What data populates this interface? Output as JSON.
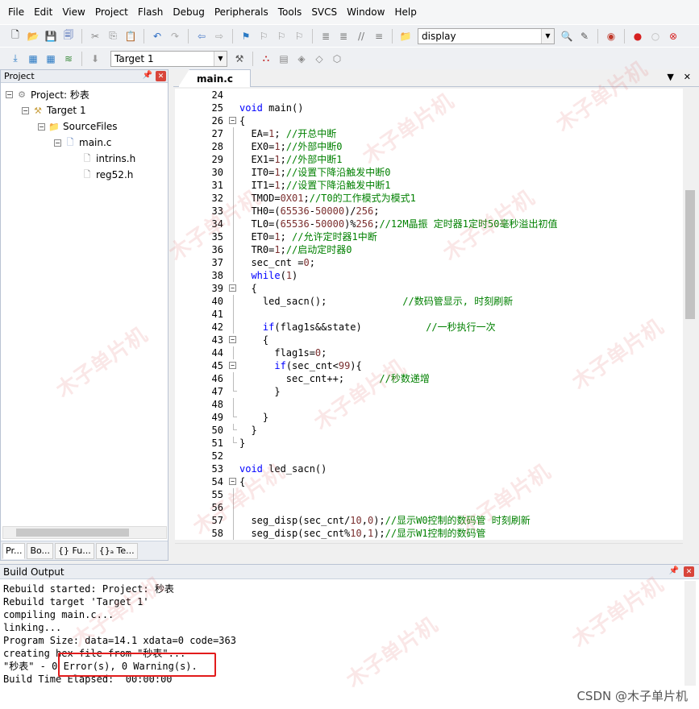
{
  "menu": [
    "File",
    "Edit",
    "View",
    "Project",
    "Flash",
    "Debug",
    "Peripherals",
    "Tools",
    "SVCS",
    "Window",
    "Help"
  ],
  "toolbar1": {
    "target_combo": "display"
  },
  "toolbar2": {
    "target_select": "Target 1"
  },
  "project_panel": {
    "title": "Project",
    "tree": {
      "root": "Project: 秒表",
      "target": "Target 1",
      "group": "SourceFiles",
      "file": "main.c",
      "headers": [
        "intrins.h",
        "reg52.h"
      ]
    },
    "tabs": [
      "Pr...",
      "Bo...",
      "{} Fu...",
      "{}ₐ Te..."
    ]
  },
  "editor": {
    "tab": "main.c",
    "lines": [
      {
        "n": "24",
        "code": ""
      },
      {
        "n": "25",
        "code": "void main()"
      },
      {
        "n": "26",
        "code": "{"
      },
      {
        "n": "27",
        "code": "  EA=1; //开总中断"
      },
      {
        "n": "28",
        "code": "  EX0=1;//外部中断0"
      },
      {
        "n": "29",
        "code": "  EX1=1;//外部中断1"
      },
      {
        "n": "30",
        "code": "  IT0=1;//设置下降沿触发中断0"
      },
      {
        "n": "31",
        "code": "  IT1=1;//设置下降沿触发中断1"
      },
      {
        "n": "32",
        "code": "  TMOD=0X01;//T0的工作模式为模式1"
      },
      {
        "n": "33",
        "code": "  TH0=(65536-50000)/256;"
      },
      {
        "n": "34",
        "code": "  TL0=(65536-50000)%256;//12M晶振 定时器1定时50毫秒溢出初值"
      },
      {
        "n": "35",
        "code": "  ET0=1; //允许定时器1中断"
      },
      {
        "n": "36",
        "code": "  TR0=1;//启动定时器0"
      },
      {
        "n": "37",
        "code": "  sec_cnt =0;"
      },
      {
        "n": "38",
        "code": "  while(1)"
      },
      {
        "n": "39",
        "code": "  {"
      },
      {
        "n": "40",
        "code": "    led_sacn();             //数码管显示, 时刻刷新"
      },
      {
        "n": "41",
        "code": ""
      },
      {
        "n": "42",
        "code": "    if(flag1s&&state)           //一秒执行一次"
      },
      {
        "n": "43",
        "code": "    {"
      },
      {
        "n": "44",
        "code": "      flag1s=0;"
      },
      {
        "n": "45",
        "code": "      if(sec_cnt<99){"
      },
      {
        "n": "46",
        "code": "        sec_cnt++;      //秒数递增"
      },
      {
        "n": "47",
        "code": "      }"
      },
      {
        "n": "48",
        "code": ""
      },
      {
        "n": "49",
        "code": "    }"
      },
      {
        "n": "50",
        "code": "  }"
      },
      {
        "n": "51",
        "code": "}"
      },
      {
        "n": "52",
        "code": ""
      },
      {
        "n": "53",
        "code": "void led_sacn()"
      },
      {
        "n": "54",
        "code": "{"
      },
      {
        "n": "55",
        "code": ""
      },
      {
        "n": "56",
        "code": ""
      },
      {
        "n": "57",
        "code": "  seg_disp(sec_cnt/10,0);//显示W0控制的数码管 时刻刷新"
      },
      {
        "n": "58",
        "code": "  seg_disp(sec_cnt%10,1);//显示W1控制的数码管"
      }
    ]
  },
  "build_output": {
    "title": "Build Output",
    "lines": [
      "Rebuild started: Project: 秒表",
      "Rebuild target 'Target 1'",
      "compiling main.c...",
      "linking...",
      "Program Size: data=14.1 xdata=0 code=363",
      "creating hex file from \"秒表\"...",
      "\"秒表\" - 0 Error(s), 0 Warning(s).",
      "Build Time Elapsed:  00:00:00"
    ]
  },
  "watermark": "木子单片机",
  "footer_credit": "CSDN @木子单片机",
  "colors": {
    "keyword": "#0000ff",
    "comment": "#008000",
    "number": "#7a2e2e",
    "highlight_box": "#e21b1b"
  }
}
